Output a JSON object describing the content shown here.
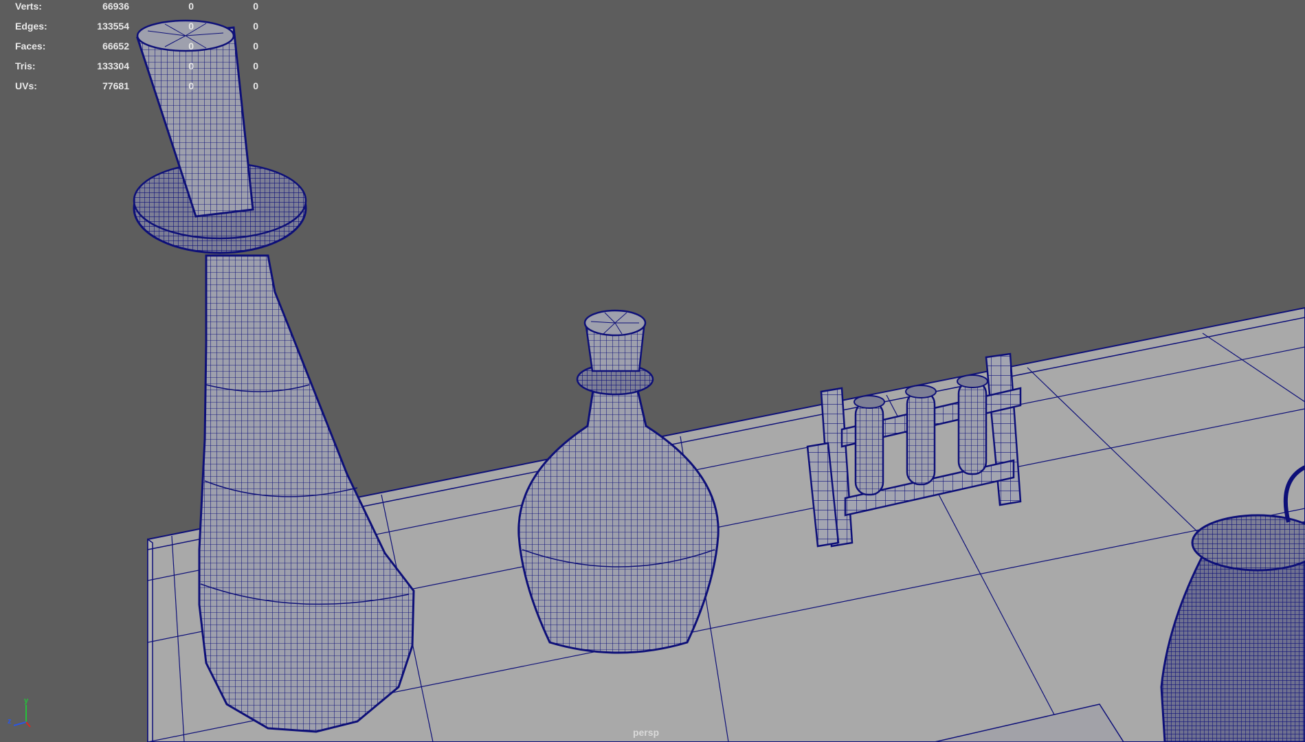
{
  "stats": {
    "rows": [
      {
        "label": "Verts:",
        "total": "66936",
        "selected": "0",
        "extra": "0"
      },
      {
        "label": "Edges:",
        "total": "133554",
        "selected": "0",
        "extra": "0"
      },
      {
        "label": "Faces:",
        "total": "66652",
        "selected": "0",
        "extra": "0"
      },
      {
        "label": "Tris:",
        "total": "133304",
        "selected": "0",
        "extra": "0"
      },
      {
        "label": "UVs:",
        "total": "77681",
        "selected": "0",
        "extra": "0"
      }
    ]
  },
  "viewport": {
    "camera_label": "persp",
    "background_color": "#5d5d5d",
    "wireframe_color": "#0d0f78",
    "surface_color": "#a9a9a9"
  },
  "axis_gizmo": {
    "y": "y",
    "z": "z",
    "x_color": "#e0261c",
    "y_color": "#24c23a",
    "z_color": "#2b56e4"
  },
  "scene_objects": [
    "tall-bottle",
    "round-flask",
    "test-tube-rack",
    "beaker",
    "tabletop"
  ]
}
